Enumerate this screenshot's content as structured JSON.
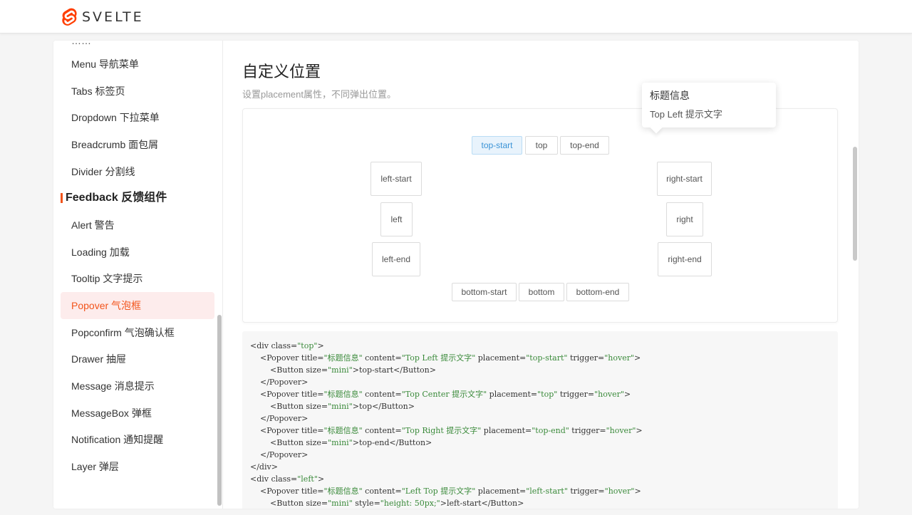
{
  "app": {
    "name": "SVELTE",
    "brand_color": "#ff3e00"
  },
  "sidebar": {
    "cut_text": "……",
    "items_nav": [
      {
        "label": "Menu 导航菜单"
      },
      {
        "label": "Tabs 标签页"
      },
      {
        "label": "Dropdown 下拉菜单"
      },
      {
        "label": "Breadcrumb 面包屑"
      },
      {
        "label": "Divider 分割线"
      }
    ],
    "group_feedback": "Feedback 反馈组件",
    "items_feedback": [
      {
        "label": "Alert 警告"
      },
      {
        "label": "Loading 加载"
      },
      {
        "label": "Tooltip 文字提示"
      },
      {
        "label": "Popover 气泡框",
        "active": true
      },
      {
        "label": "Popconfirm 气泡确认框"
      },
      {
        "label": "Drawer 抽屉"
      },
      {
        "label": "Message 消息提示"
      },
      {
        "label": "MessageBox 弹框"
      },
      {
        "label": "Notification 通知提醒"
      },
      {
        "label": "Layer 弹层"
      }
    ]
  },
  "main": {
    "title": "自定义位置",
    "description": "设置placement属性，不同弹出位置。",
    "buttons": {
      "top_start": "top-start",
      "top": "top",
      "top_end": "top-end",
      "left_start": "left-start",
      "left": "left",
      "left_end": "left-end",
      "right_start": "right-start",
      "right": "right",
      "right_end": "right-end",
      "bottom_start": "bottom-start",
      "bottom": "bottom",
      "bottom_end": "bottom-end"
    },
    "popover": {
      "title": "标题信息",
      "content": "Top Left 提示文字"
    }
  },
  "code": {
    "lines": [
      [
        "<div class=",
        "\"top\"",
        ">"
      ],
      [
        "    <Popover title=",
        "\"标题信息\"",
        " content=",
        "\"Top Left 提示文字\"",
        " placement=",
        "\"top-start\"",
        " trigger=",
        "\"hover\"",
        ">"
      ],
      [
        "        <Button size=",
        "\"mini\"",
        ">top-start</Button>"
      ],
      [
        "    </Popover>"
      ],
      [
        "    <Popover title=",
        "\"标题信息\"",
        " content=",
        "\"Top Center 提示文字\"",
        " placement=",
        "\"top\"",
        " trigger=",
        "\"hover\"",
        ">"
      ],
      [
        "        <Button size=",
        "\"mini\"",
        ">top</Button>"
      ],
      [
        "    </Popover>"
      ],
      [
        "    <Popover title=",
        "\"标题信息\"",
        " content=",
        "\"Top Right 提示文字\"",
        " placement=",
        "\"top-end\"",
        " trigger=",
        "\"hover\"",
        ">"
      ],
      [
        "        <Button size=",
        "\"mini\"",
        ">top-end</Button>"
      ],
      [
        "    </Popover>"
      ],
      [
        "</div>"
      ],
      [
        "<div class=",
        "\"left\"",
        ">"
      ],
      [
        "    <Popover title=",
        "\"标题信息\"",
        " content=",
        "\"Left Top 提示文字\"",
        " placement=",
        "\"left-start\"",
        " trigger=",
        "\"hover\"",
        ">"
      ],
      [
        "        <Button size=",
        "\"mini\"",
        " style=",
        "\"height: 50px;\"",
        ">left-start</Button>"
      ]
    ]
  }
}
